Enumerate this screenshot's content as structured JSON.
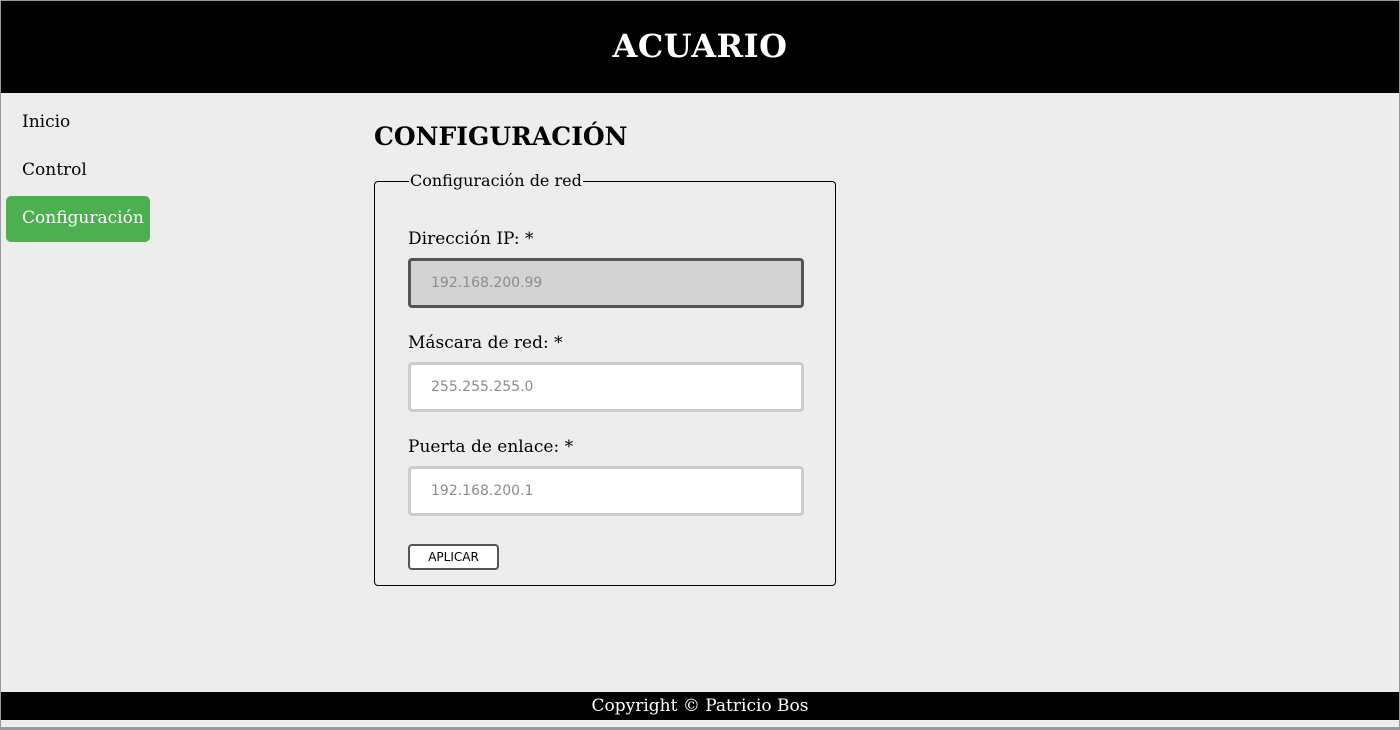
{
  "header": {
    "title": "ACUARIO"
  },
  "sidebar": {
    "items": [
      {
        "label": "Inicio",
        "active": false
      },
      {
        "label": "Control",
        "active": false
      },
      {
        "label": "Configuración",
        "active": true
      }
    ],
    "active_color": "#4caf50"
  },
  "main": {
    "title": "CONFIGURACIÓN",
    "network": {
      "legend": "Configuración de red",
      "ip": {
        "label": "Dirección IP: *",
        "value": "",
        "placeholder": "192.168.200.99"
      },
      "mask": {
        "label": "Máscara de red: *",
        "value": "",
        "placeholder": "255.255.255.0"
      },
      "gateway": {
        "label": "Puerta de enlace: *",
        "value": "",
        "placeholder": "192.168.200.1"
      },
      "apply_label": "APLICAR"
    }
  },
  "footer": {
    "text": "Copyright © Patricio Bos"
  }
}
